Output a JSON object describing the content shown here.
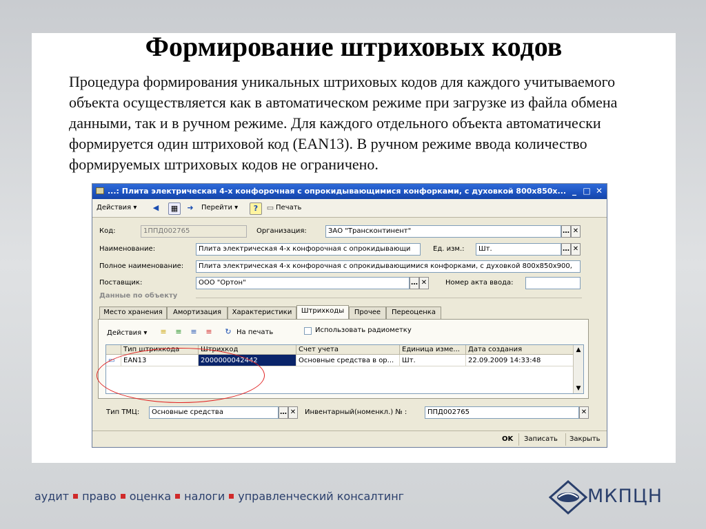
{
  "slide": {
    "title": "Формирование штриховых кодов",
    "body": "Процедура формирования уникальных штриховых кодов для каждого учитываемого объекта осуществляется как в автоматическом режиме при загрузке из файла обмена данными, так и в ручном режиме. Для каждого отдельного объекта автоматически формируется один штриховой код (EAN13). В ручном режиме ввода количество формируемых штриховых кодов не ограничено."
  },
  "window": {
    "title": "...: Плита электрическая 4-х конфорочная с опрокидывающимися конфорками, с духовкой 800х850х...",
    "toolbar": {
      "actions": "Действия",
      "goto": "Перейти",
      "print": "Печать"
    },
    "form": {
      "code_label": "Код:",
      "code_value": "1ППД002765",
      "org_label": "Организация:",
      "org_value": "ЗАО \"Трансконтинент\"",
      "name_label": "Наименование:",
      "name_value": "Плита электрическая 4-х конфорочная с опрокидывающи",
      "unit_label": "Ед. изм.:",
      "unit_value": "Шт.",
      "fullname_label": "Полное наименование:",
      "fullname_value": "Плита электрическая 4-х конфорочная с опрокидывающимися конфорками, с духовкой 800х850х900,",
      "supplier_label": "Поставщик:",
      "supplier_value": "ООО \"Ортон\"",
      "act_label": "Номер акта ввода:",
      "act_value": "",
      "section_title": "Данные по объекту"
    },
    "tabs": [
      "Место хранения",
      "Амортизация",
      "Характеристики",
      "Штрихкоды",
      "Прочее",
      "Переоценка"
    ],
    "active_tab": "Штрихкоды",
    "panel": {
      "actions": "Действия",
      "print": "На печать",
      "radio_label": "Использовать радиометку",
      "columns": [
        "Тип штрихкода",
        "Штрихкод",
        "Счет учета",
        "Единица изме...",
        "Дата создания"
      ],
      "rows": [
        [
          "EAN13",
          "2000000042442",
          "Основные средства в ор...",
          "Шт.",
          "22.09.2009 14:33:48"
        ]
      ]
    },
    "bottom": {
      "tmc_label": "Тип ТМЦ:",
      "tmc_value": "Основные средства",
      "inv_label": "Инвентарный(номенкл.) № :",
      "inv_value": "ППД002765"
    },
    "buttons": {
      "ok": "OK",
      "save": "Записать",
      "close": "Закрыть"
    }
  },
  "footer": {
    "tagline": [
      "аудит",
      "право",
      "оценка",
      "налоги",
      "управленческий консалтинг"
    ],
    "logo_text": "МКПЦН"
  },
  "colors": {
    "title_bar": "#1c52c0",
    "selection": "#0a246a",
    "highlight_ellipse": "#e02020",
    "footer_text": "#2a3f6c",
    "footer_dot": "#d02a2a"
  }
}
